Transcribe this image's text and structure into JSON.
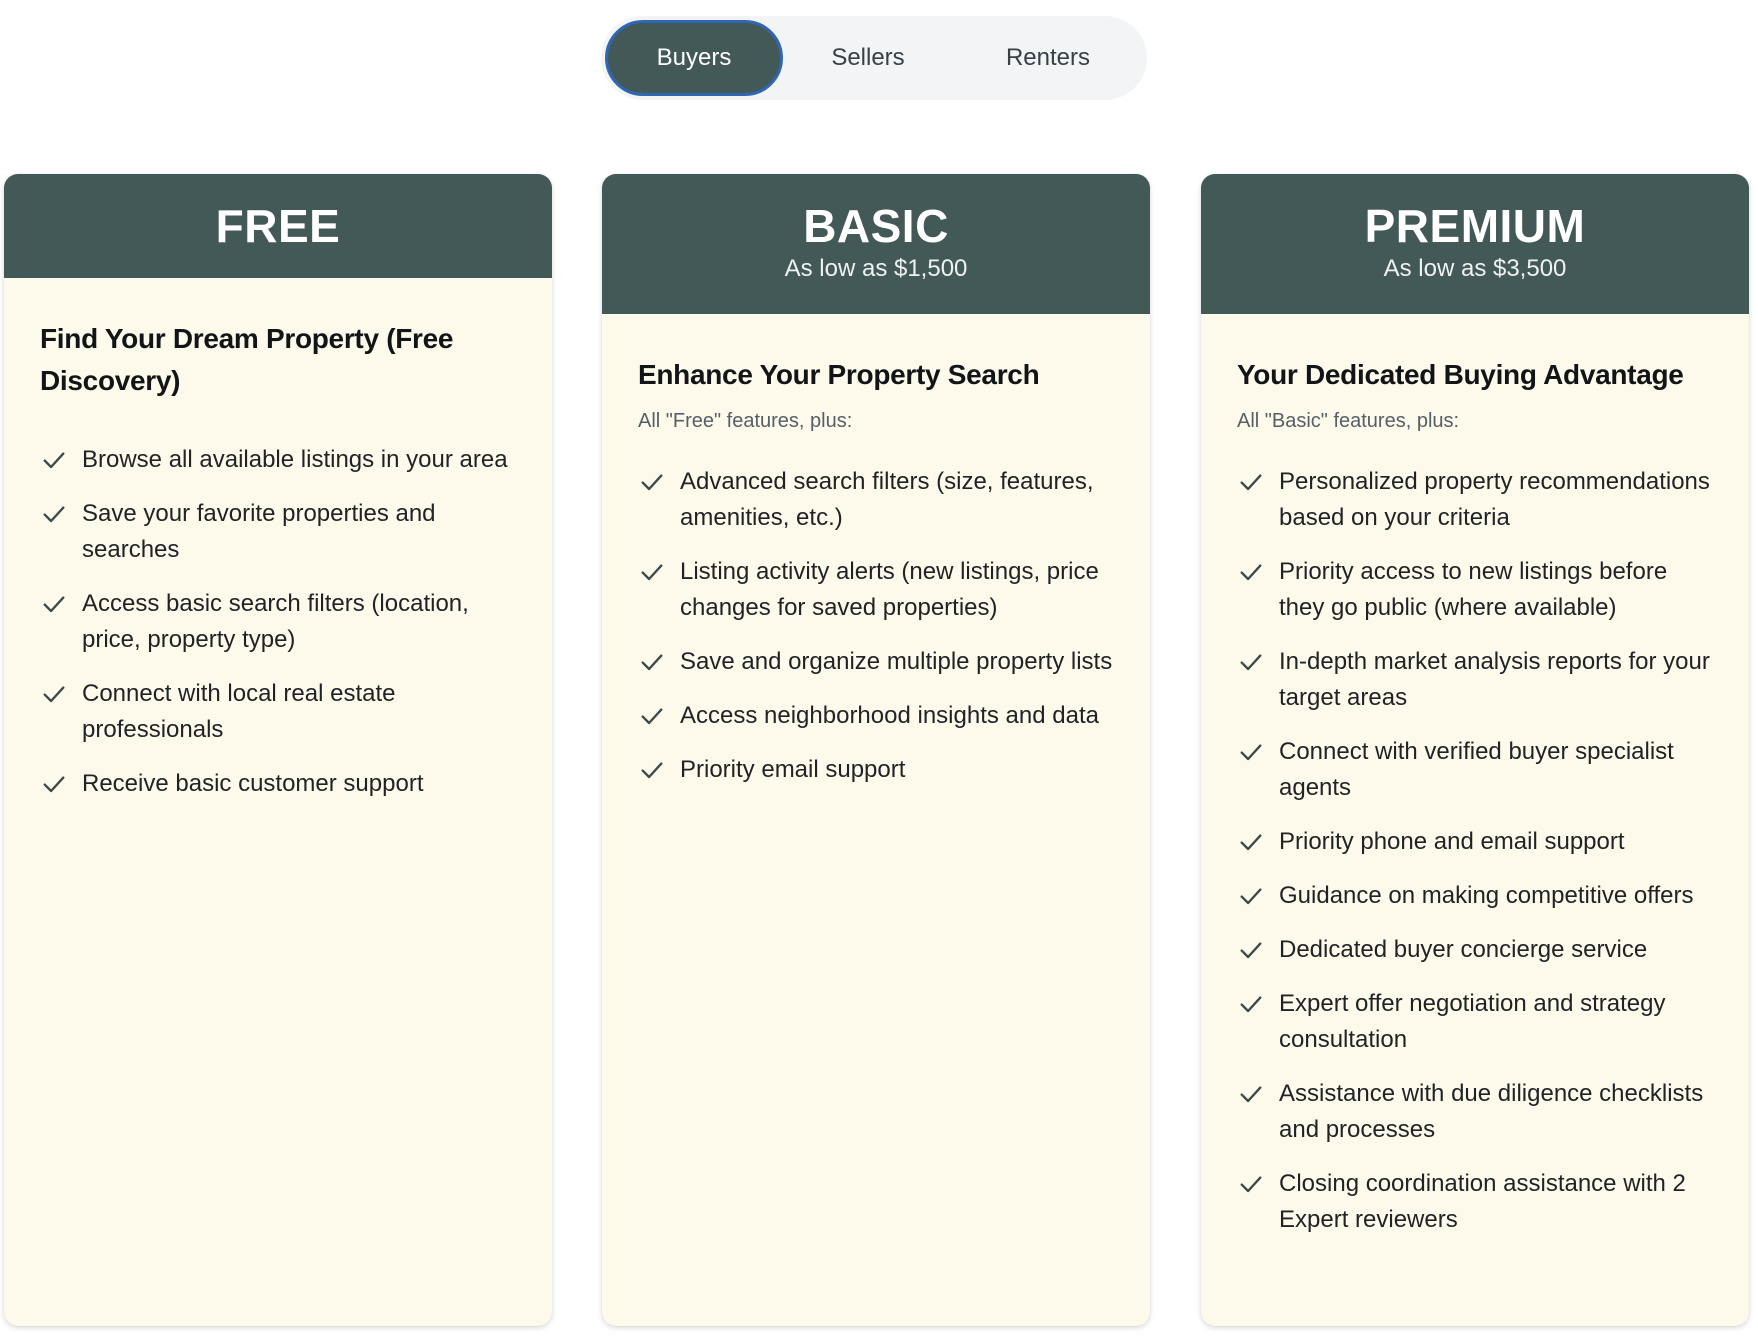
{
  "tabs": [
    "Buyers",
    "Sellers",
    "Renters"
  ],
  "active_tab": "Buyers",
  "colors": {
    "header": "#435957",
    "card_bg": "#fdfaeb",
    "active_tab_border": "#2f67b5",
    "tab_track": "#f2f4f6"
  },
  "icons": {
    "feature": "check-icon"
  },
  "plans": [
    {
      "name": "FREE",
      "price": "",
      "title": "Find Your Dream Property (Free Discovery)",
      "subtitle": "",
      "features": [
        "Browse all available listings in your area",
        "Save your favorite properties and searches",
        "Access basic search filters (location, price, property type)",
        "Connect with local real estate professionals",
        "Receive basic customer support"
      ]
    },
    {
      "name": "BASIC",
      "price": "As low as $1,500",
      "title": "Enhance Your Property Search",
      "subtitle": "All \"Free\" features, plus:",
      "features": [
        "Advanced search filters (size, features, amenities, etc.)",
        "Listing activity alerts (new listings, price changes for saved properties)",
        "Save and organize multiple property lists",
        "Access neighborhood insights and data",
        "Priority email support"
      ]
    },
    {
      "name": "PREMIUM",
      "price": "As low as $3,500",
      "title": "Your Dedicated Buying Advantage",
      "subtitle": "All \"Basic\" features, plus:",
      "features": [
        "Personalized property recommendations based on your criteria",
        "Priority access to new listings before they go public (where available)",
        "In-depth market analysis reports for your target areas",
        "Connect with verified buyer specialist agents",
        "Priority phone and email support",
        "Guidance on making competitive offers",
        "Dedicated buyer concierge service",
        "Expert offer negotiation and strategy consultation",
        "Assistance with due diligence checklists and processes",
        "Closing coordination assistance with 2 Expert reviewers"
      ]
    }
  ]
}
